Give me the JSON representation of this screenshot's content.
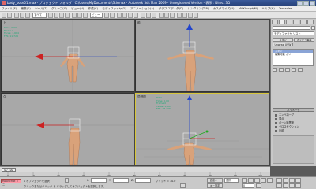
{
  "window": {
    "title": "body_pose01.max - プロジェクト フォルダ : C:\\Users\\MyDocuments\\3dsmax - Autodesk 3ds Max 2009 - Unregistered Version - 表示 : Direct 3D"
  },
  "menu": [
    "ファイル(F)",
    "編集(E)",
    "ツール(T)",
    "グループ(G)",
    "ビュー(V)",
    "作成(C)",
    "モディファイヤ(O)",
    "アニメーション(A)",
    "グラフ エディタ(D)",
    "レンダリング(R)",
    "カスタマイズ(U)",
    "MAXScript(M)",
    "ヘルプ(H)",
    "Tentacles"
  ],
  "toolbar": {
    "select_filter": "すべて",
    "view_dropdown": "ビュー"
  },
  "viewports": [
    {
      "label": "上",
      "info": [
        "Time: 0.00",
        "Frame 0",
        "Faces: 1,664",
        "FPS: 11.724"
      ]
    },
    {
      "label": "前",
      "info": []
    },
    {
      "label": "左",
      "info": []
    },
    {
      "label": "透視図",
      "info": [
        "Total",
        "Time: 0.00",
        "Frame 0",
        "Faces: 1,664",
        "FPS: 18.406"
      ]
    }
  ],
  "command_panel": {
    "object_name": "モディファイヤ リスト",
    "buttons": [
      "スキン",
      "メッシュ編集",
      "Unwrap UVW"
    ],
    "stack": [
      "スキン",
      "編集可能 ポリ"
    ],
    "rollout": "パラメータ",
    "options": [
      {
        "label": "エンベロープ",
        "checked": true
      },
      {
        "label": "頂点",
        "checked": false
      },
      {
        "label": "ボーン影響度",
        "checked": true
      },
      {
        "label": "クロスセクション",
        "checked": false
      },
      {
        "label": "反射",
        "checked": true
      }
    ]
  },
  "timeline": {
    "slider": "0 / 100",
    "ticks": [
      "0",
      "10",
      "20",
      "30",
      "40",
      "50",
      "60",
      "70",
      "80",
      "90",
      "100"
    ]
  },
  "status": {
    "maxscript": "MAXScript ミニ",
    "selection": "1 オブジェクトを選択",
    "prompt": "クリックまたはクリック ＆ ドラッグしてオブジェクトを選択します。",
    "x_label": "X:",
    "x": "",
    "y_label": "Y:",
    "y": "",
    "z_label": "Z:",
    "z": "",
    "grid": "グリッド = 10.0",
    "autokey": "自動キー",
    "setkey": "キー設定",
    "keyfilter": "選択",
    "frame": "0"
  },
  "colors": {
    "active_border": "#d8c63a",
    "x_axis": "#cc2222",
    "y_axis": "#22aa22",
    "z_axis": "#2244cc",
    "skin": "#d9a27a"
  }
}
